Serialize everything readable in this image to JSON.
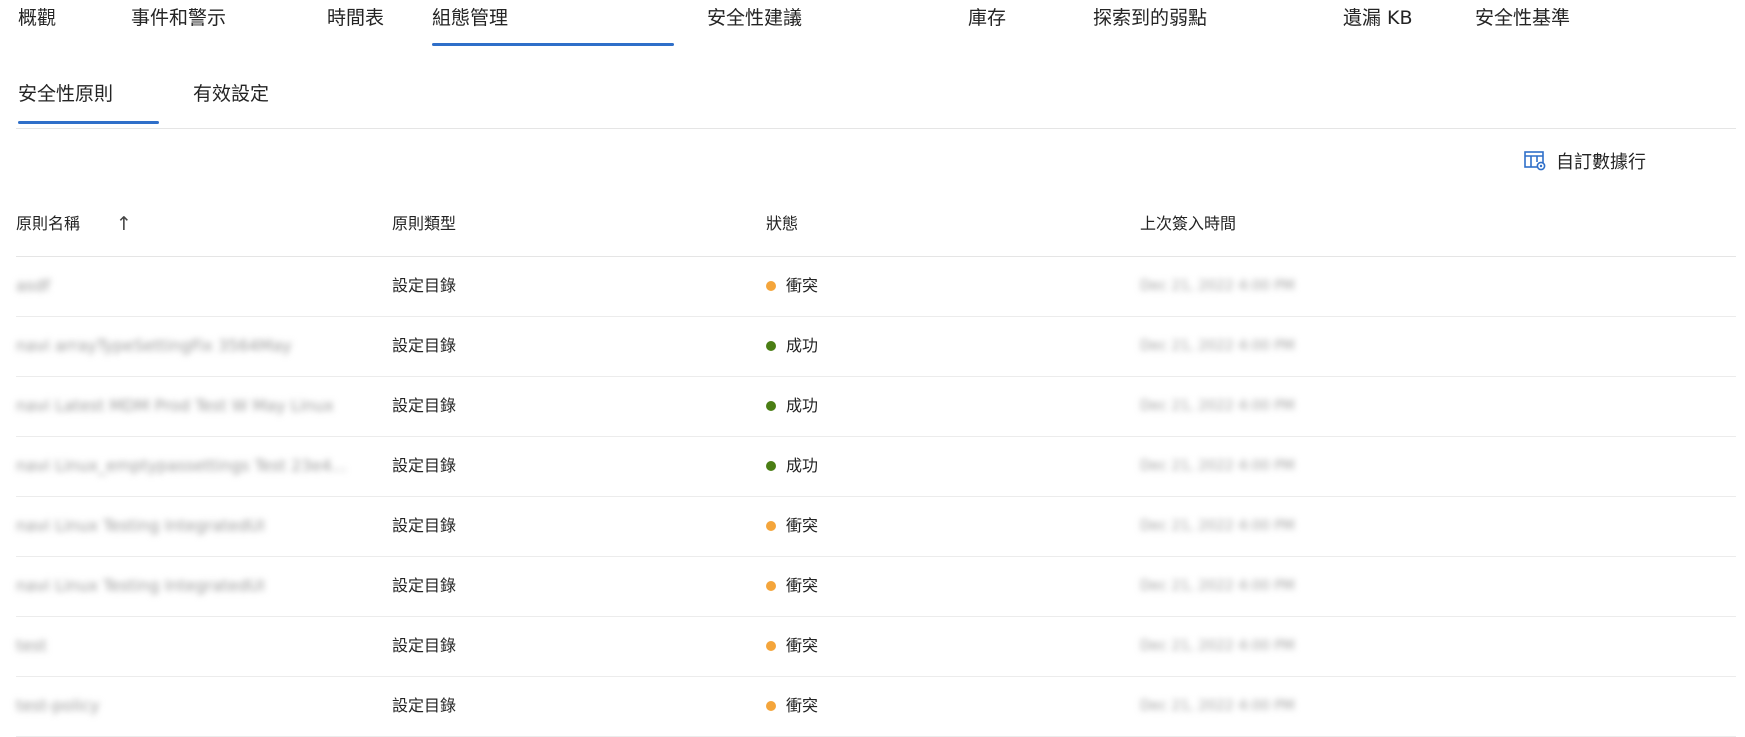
{
  "top_tabs": [
    {
      "label": "概觀"
    },
    {
      "label": "事件和警示"
    },
    {
      "label": "時間表"
    },
    {
      "label": "組態管理"
    },
    {
      "label": "安全性建議"
    },
    {
      "label": "庫存"
    },
    {
      "label": "探索到的弱點"
    },
    {
      "label": "遺漏 KB"
    },
    {
      "label": "安全性基準"
    }
  ],
  "active_top_tab": "組態管理",
  "sub_tabs": [
    {
      "label": "安全性原則"
    },
    {
      "label": "有效設定"
    }
  ],
  "active_sub_tab": "安全性原則",
  "toolbar": {
    "customize_label": "自訂數據行",
    "customize_icon": "customize-columns-icon"
  },
  "table": {
    "columns": [
      {
        "label": "原則名稱",
        "sort": "ascending",
        "sort_icon": "↑"
      },
      {
        "label": "原則類型"
      },
      {
        "label": "狀態"
      },
      {
        "label": "上次簽入時間"
      }
    ],
    "rows": [
      {
        "name": "asdf",
        "type": "設定目錄",
        "status": "衝突",
        "status_color": "#f4a53b",
        "checkin": "Dec 21, 2022 4:00 PM"
      },
      {
        "name": "navi arrayTypeSettingFix 3564May",
        "type": "設定目錄",
        "status": "成功",
        "status_color": "#4a7e14",
        "checkin": "Dec 21, 2022 4:00 PM"
      },
      {
        "name": "navi Latest MDM Prod Test W May Linux",
        "type": "設定目錄",
        "status": "成功",
        "status_color": "#4a7e14",
        "checkin": "Dec 21, 2022 4:00 PM"
      },
      {
        "name": "navi Linux_emptypassettings Test 23e4...",
        "type": "設定目錄",
        "status": "成功",
        "status_color": "#4a7e14",
        "checkin": "Dec 21, 2022 4:00 PM"
      },
      {
        "name": "navi Linux Testing IntegratedUI",
        "type": "設定目錄",
        "status": "衝突",
        "status_color": "#f4a53b",
        "checkin": "Dec 21, 2022 4:00 PM"
      },
      {
        "name": "navi Linux Testing IntegratedUI",
        "type": "設定目錄",
        "status": "衝突",
        "status_color": "#f4a53b",
        "checkin": "Dec 21, 2022 4:00 PM"
      },
      {
        "name": "test",
        "type": "設定目錄",
        "status": "衝突",
        "status_color": "#f4a53b",
        "checkin": "Dec 21, 2022 4:00 PM"
      },
      {
        "name": "test-policy",
        "type": "設定目錄",
        "status": "衝突",
        "status_color": "#f4a53b",
        "checkin": "Dec 21, 2022 4:00 PM"
      }
    ]
  },
  "colors": {
    "accent": "#2f6fc9",
    "conflict": "#f4a53b",
    "success": "#4a7e14"
  }
}
